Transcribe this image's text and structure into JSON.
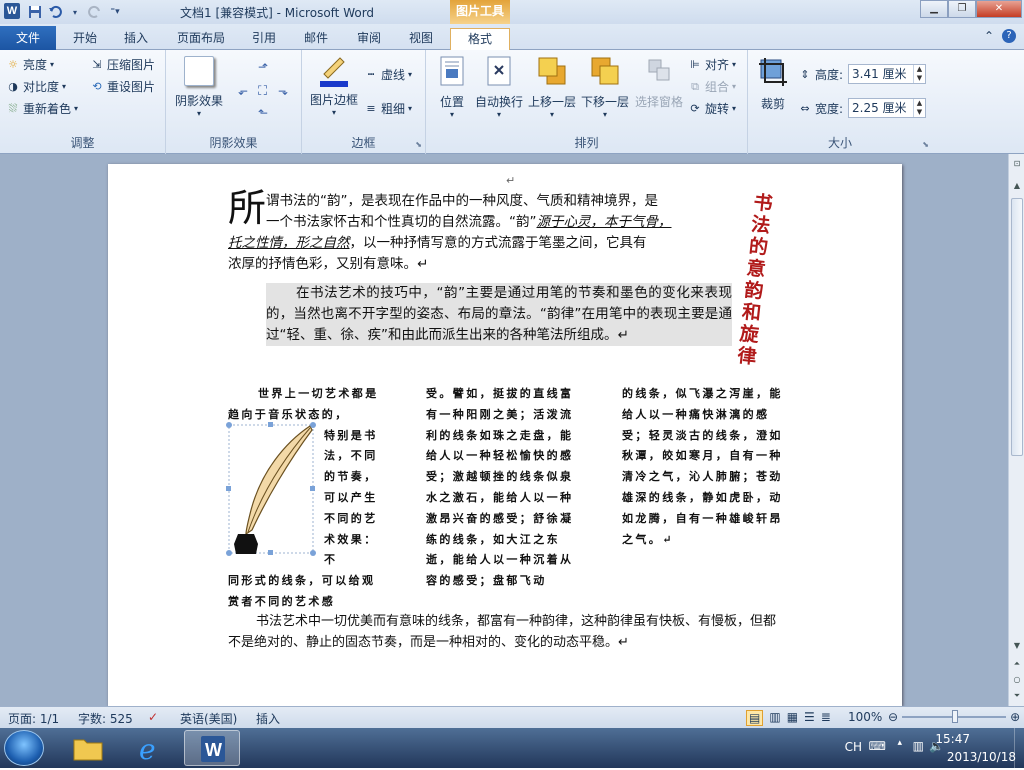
{
  "window": {
    "title": "文档1 [兼容模式] - Microsoft Word",
    "context_tab_group": "图片工具",
    "app_icon": "W"
  },
  "qat": {
    "save_icon": "save-icon",
    "undo_icon": "undo-icon",
    "redo_icon": "redo-icon"
  },
  "tabs": [
    {
      "label": "文件"
    },
    {
      "label": "开始"
    },
    {
      "label": "插入"
    },
    {
      "label": "页面布局"
    },
    {
      "label": "引用"
    },
    {
      "label": "邮件"
    },
    {
      "label": "审阅"
    },
    {
      "label": "视图"
    },
    {
      "label": "格式"
    }
  ],
  "ribbon": {
    "adjust": {
      "label": "调整",
      "brightness": "亮度",
      "contrast": "对比度",
      "recolor": "重新着色",
      "compress": "压缩图片",
      "reset": "重设图片"
    },
    "shadow": {
      "label": "阴影效果",
      "shadow_btn": "阴影效果"
    },
    "border": {
      "label": "边框",
      "picture_border": "图片边框",
      "dashes": "虚线",
      "weight": "粗细"
    },
    "arrange": {
      "label": "排列",
      "position": "位置",
      "wrap": "自动换行",
      "bring_forward": "上移一层",
      "send_backward": "下移一层",
      "selection_pane": "选择窗格",
      "align": "对齐",
      "group": "组合",
      "rotate": "旋转"
    },
    "size": {
      "label": "大小",
      "crop": "裁剪",
      "height_label": "高度:",
      "height_value": "3.41 厘米",
      "width_label": "宽度:",
      "width_value": "2.25 厘米"
    }
  },
  "document": {
    "dropcap": "所",
    "p1_line1": "谓书法的“韵”，是表现在作品中的一种风度、气质和精神境界，是",
    "p1_line2a": "一个书法家怀古和个性真切的自然流露。“韵”",
    "p1_line2b": "源于心灵，本于气骨，",
    "p1_line3a": "托之性情，形之自然",
    "p1_line3b": "，以一种抒情写意的方式流露于笔墨之间，它具有",
    "p1_line4": "浓厚的抒情色彩，又别有意味。↵",
    "p2": "在书法艺术的技巧中，“韵”主要是通过用笔的节奏和墨色的变化来表现的，当然也离不开字型的姿态、布局的章法。“韵律”在用笔中的表现主要是通过“轻、重、徐、疾”和由此而派生出来的各种笔法所组成。↵",
    "vertical_title": "书法的意韵和旋律",
    "col1_top": "世界上一切艺术都是趋向于音乐状态的，",
    "col1_narrow": "特别是书法，不同的节奏，可以产生不同的艺术效果：不",
    "col1_bottom": "同形式的线条，可以给观赏者不同的艺术感",
    "col2": "受。譬如，挺拔的直线富有一种阳刚之美；活泼流利的线条如珠之走盘，能给人以一种轻松愉快的感受；激越顿挫的线条似泉水之激石，能给人以一种激昂兴奋的感受；舒徐凝练的线条，如大江之东逝，能给人以一种沉着从容的感受；盘郁飞动",
    "col3": "的线条，似飞瀑之泻崖，能给人以一种痛快淋漓的感受；轻灵淡古的线条，澄如秋潭，皎如寒月，自有一种清冷之气，沁人肺腑；苍劲雄深的线条，静如虎卧，动如龙腾，自有一种雄峻轩昂之气。↵",
    "p3": "书法艺术中一切优美而有意味的线条，都富有一种韵律，这种韵律虽有快板、有慢板，但都不是绝对的、静止的固态节奏，而是一种相对的、变化的动态平稳。↵",
    "top_mark": "↵"
  },
  "statusbar": {
    "page": "页面: 1/1",
    "words": "字数: 525",
    "language": "英语(美国)",
    "mode": "插入",
    "zoom": "100%"
  },
  "taskbar": {
    "ime": "CH",
    "time": "15:47",
    "date": "2013/10/18"
  },
  "colors": {
    "title_accent": "#b11a1a",
    "file_tab": "#1c55a3",
    "context_tab": "#e3a33a"
  }
}
